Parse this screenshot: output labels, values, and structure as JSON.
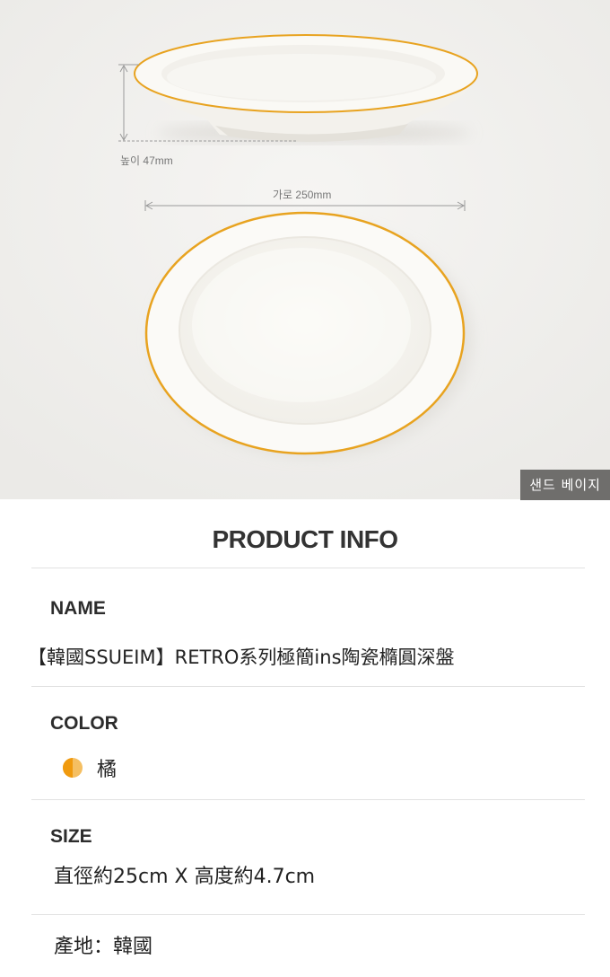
{
  "photo": {
    "height_label": "높이 47mm",
    "width_label": "가로 250mm",
    "color_badge": "샌드 베이지"
  },
  "info": {
    "title": "PRODUCT INFO",
    "name_label": "NAME",
    "name_value": "【韓國SSUEIM】RETRO系列極簡ins陶瓷橢圓深盤",
    "color_label": "COLOR",
    "color_value": "橘",
    "swatch_colors": [
      "#f09a0e",
      "#f5bf62"
    ],
    "size_label": "SIZE",
    "size_value": "直徑約25cm X 高度約4.7cm",
    "origin": "產地：韓國"
  },
  "colors": {
    "rim": "#e8a320",
    "background": "#f1f0ee"
  }
}
